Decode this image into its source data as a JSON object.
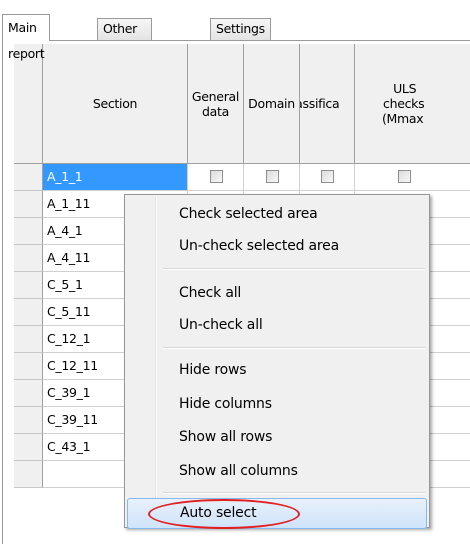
{
  "tabs": [
    {
      "label": "Main report",
      "active": true
    },
    {
      "label": "Other reports",
      "active": false
    },
    {
      "label": "Settings",
      "active": false
    }
  ],
  "grid": {
    "columns": {
      "section": "Section",
      "general": [
        "General",
        "data"
      ],
      "domain": "Domain",
      "classification": "lassifica",
      "uls": [
        "ULS",
        "checks",
        "(Mmax"
      ]
    },
    "rows": [
      {
        "name": "A_1_1",
        "selected": true
      },
      {
        "name": "A_1_11",
        "selected": false
      },
      {
        "name": "A_4_1",
        "selected": false
      },
      {
        "name": "A_4_11",
        "selected": false
      },
      {
        "name": "C_5_1",
        "selected": false
      },
      {
        "name": "C_5_11",
        "selected": false
      },
      {
        "name": "C_12_1",
        "selected": false
      },
      {
        "name": "C_12_11",
        "selected": false
      },
      {
        "name": "C_39_1",
        "selected": false
      },
      {
        "name": "C_39_11",
        "selected": false
      },
      {
        "name": "C_43_1",
        "selected": false
      },
      {
        "name": "",
        "selected": false
      }
    ]
  },
  "context_menu": {
    "groups": [
      [
        "Check selected area",
        "Un-check selected area"
      ],
      [
        "Check all",
        "Un-check all"
      ],
      [
        "Hide rows",
        "Hide columns",
        "Show all rows",
        "Show all columns"
      ],
      [
        "Auto select"
      ]
    ],
    "highlighted": "Auto select"
  },
  "colors": {
    "selection": "#3399ff",
    "annotation": "#e02020",
    "menu_hover_border": "#84b9ec"
  }
}
